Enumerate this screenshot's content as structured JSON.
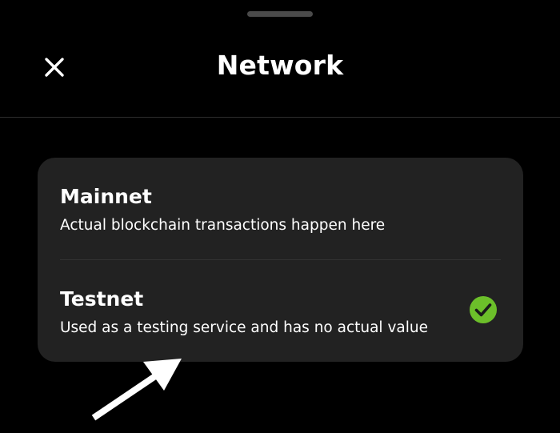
{
  "header": {
    "title": "Network",
    "close_icon": "close-icon"
  },
  "options": [
    {
      "title": "Mainnet",
      "description": "Actual blockchain transactions happen here",
      "selected": false
    },
    {
      "title": "Testnet",
      "description": "Used as a testing service and has no actual value",
      "selected": true
    }
  ],
  "colors": {
    "background": "#000000",
    "card": "#222222",
    "check": "#6cbf2a",
    "text": "#ffffff"
  },
  "annotation": {
    "icon": "arrow-icon",
    "color": "#ffffff"
  }
}
